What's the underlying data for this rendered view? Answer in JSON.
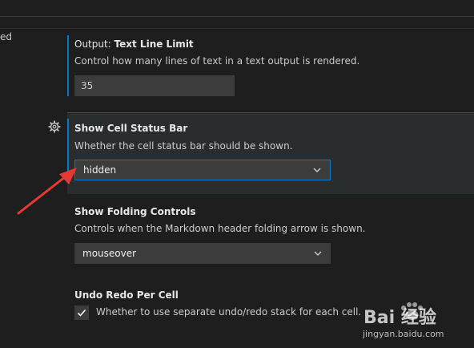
{
  "left_fragment": "ed",
  "settings": {
    "output_text_line_limit": {
      "category": "Output: ",
      "title": "Text Line Limit",
      "description": "Control how many lines of text in a text output is rendered.",
      "value": "35"
    },
    "show_cell_status_bar": {
      "title": "Show Cell Status Bar",
      "description": "Whether the cell status bar should be shown.",
      "value": "hidden"
    },
    "show_folding_controls": {
      "title": "Show Folding Controls",
      "description": "Controls when the Markdown header folding arrow is shown.",
      "value": "mouseover"
    },
    "undo_redo_per_cell": {
      "title": "Undo Redo Per Cell",
      "checked": true,
      "label": "Whether to use separate undo/redo stack for each cell."
    }
  },
  "watermark": {
    "main": "Bai 经验",
    "sub": "jingyan.baidu.com"
  },
  "colors": {
    "accent": "#007acc",
    "background": "#1e1e1e",
    "annotation_arrow": "#e53935"
  },
  "icons": {
    "gear": "gear-icon",
    "chevron": "chevron-down-icon",
    "check": "check-icon"
  }
}
